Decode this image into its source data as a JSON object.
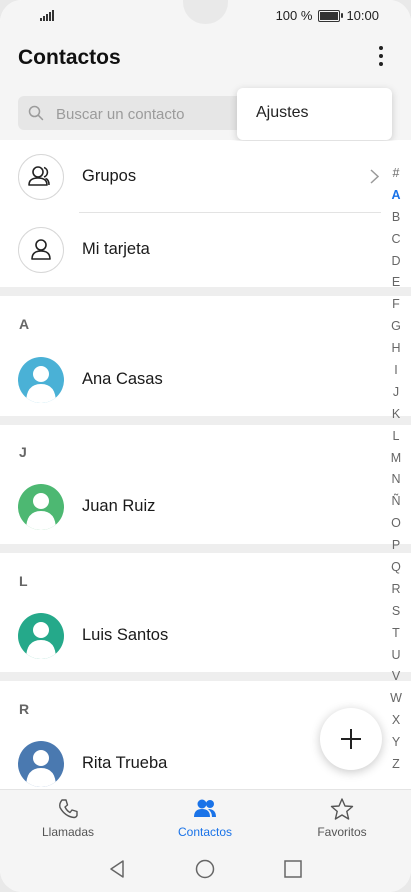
{
  "status": {
    "battery": "100 %",
    "time": "10:00",
    "battery_level": 1.0
  },
  "appbar": {
    "title": "Contactos"
  },
  "search": {
    "placeholder": "Buscar un contacto"
  },
  "menu": {
    "items": [
      "Ajustes"
    ]
  },
  "rows": {
    "groups": "Grupos",
    "my_card": "Mi tarjeta"
  },
  "sections": [
    {
      "letter": "A",
      "name": "Ana Casas",
      "color": "#4ab1d6"
    },
    {
      "letter": "J",
      "name": "Juan Ruiz",
      "color": "#4db872"
    },
    {
      "letter": "L",
      "name": "Luis Santos",
      "color": "#25a98a"
    },
    {
      "letter": "R",
      "name": "Rita Trueba",
      "color": "#4a79b0"
    }
  ],
  "index": [
    "#",
    "A",
    "B",
    "C",
    "D",
    "E",
    "F",
    "G",
    "H",
    "I",
    "J",
    "K",
    "L",
    "M",
    "N",
    "Ñ",
    "O",
    "P",
    "Q",
    "R",
    "S",
    "T",
    "U",
    "V",
    "W",
    "X",
    "Y",
    "Z"
  ],
  "index_active": "A",
  "bottom_tabs": [
    {
      "label": "Llamadas",
      "icon": "phone-icon"
    },
    {
      "label": "Contactos",
      "icon": "contacts-icon",
      "active": true
    },
    {
      "label": "Favoritos",
      "icon": "star-icon"
    }
  ],
  "colors": {
    "accent": "#1a73e8"
  }
}
